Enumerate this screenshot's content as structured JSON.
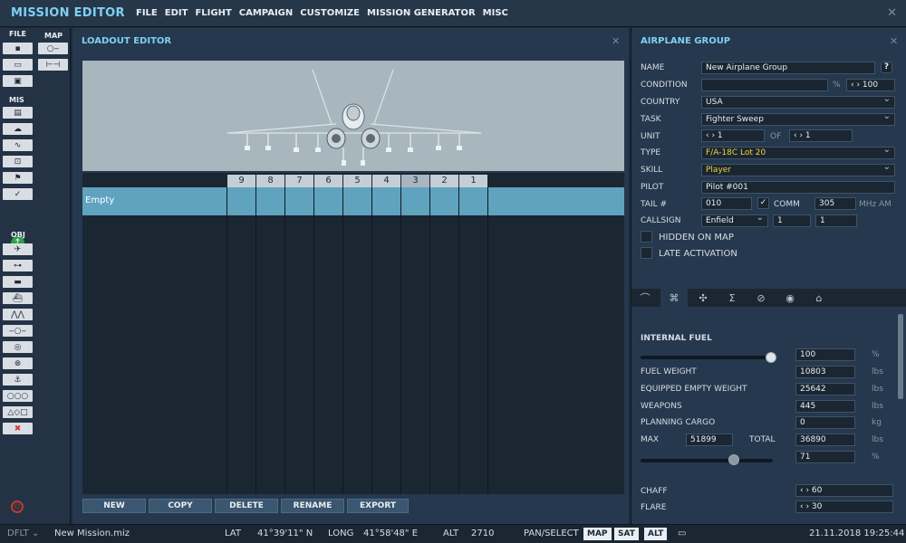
{
  "app": {
    "title": "MISSION EDITOR",
    "menu": [
      "FILE",
      "EDIT",
      "FLIGHT",
      "CAMPAIGN",
      "CUSTOMIZE",
      "MISSION GENERATOR",
      "MISC"
    ],
    "close_icon": "close-icon"
  },
  "toolbar": {
    "file_label": "FILE",
    "map_label": "MAP",
    "mis_label": "MIS",
    "obj_label": "OBJ"
  },
  "loadout": {
    "title": "LOADOUT EDITOR",
    "stations": [
      "9",
      "8",
      "7",
      "6",
      "5",
      "4",
      "3",
      "2",
      "1"
    ],
    "row_label": "Empty",
    "buttons": [
      "NEW",
      "COPY",
      "DELETE",
      "RENAME",
      "EXPORT"
    ]
  },
  "group": {
    "title": "AIRPLANE GROUP",
    "name_label": "NAME",
    "name_value": "New Airplane Group",
    "help": "?",
    "condition_label": "CONDITION",
    "condition_value": "",
    "percent": "%",
    "condition_prob": "100",
    "country_label": "COUNTRY",
    "country_value": "USA",
    "task_label": "TASK",
    "task_value": "Fighter Sweep",
    "unit_label": "UNIT",
    "unit_value": "1",
    "of_label": "OF",
    "unit_of": "1",
    "type_label": "TYPE",
    "type_value": "F/A-18C Lot 20",
    "skill_label": "SKILL",
    "skill_value": "Player",
    "pilot_label": "PILOT",
    "pilot_value": "Pilot #001",
    "tail_label": "TAIL #",
    "tail_value": "010",
    "comm_label": "COMM",
    "comm_value": "305",
    "freq_unit": "MHz",
    "mod": "AM",
    "callsign_label": "CALLSIGN",
    "callsign_value": "Enfield",
    "callsign_n1": "1",
    "callsign_n2": "1",
    "hidden_label": "HIDDEN ON MAP",
    "late_label": "LATE ACTIVATION"
  },
  "fuel": {
    "title": "INTERNAL FUEL",
    "fuel_pct": "100",
    "fuel_pct_unit": "%",
    "fuel_weight_label": "FUEL WEIGHT",
    "fuel_weight": "10803",
    "lbs": "lbs",
    "empty_weight_label": "EQUIPPED EMPTY WEIGHT",
    "empty_weight": "25642",
    "weapons_label": "WEAPONS",
    "weapons": "445",
    "cargo_label": "PLANNING CARGO",
    "cargo": "0",
    "kg": "kg",
    "max_label": "MAX",
    "max": "51899",
    "total_label": "TOTAL",
    "total": "36890",
    "load_pct": "71",
    "load_pct_unit": "%",
    "chaff_label": "CHAFF",
    "chaff": "60",
    "flare_label": "FLARE",
    "flare": "30"
  },
  "status": {
    "profile": "DFLT",
    "file": "New Mission.miz",
    "lat_label": "LAT",
    "lat": "41°39'11\" N",
    "long_label": "LONG",
    "long": "41°58'48\" E",
    "alt_label": "ALT",
    "alt": "2710",
    "mode": "PAN/SELECT",
    "map_btn": "MAP",
    "sat_btn": "SAT",
    "alt_btn": "ALT",
    "datetime": "21.11.2018 19:25:44"
  }
}
